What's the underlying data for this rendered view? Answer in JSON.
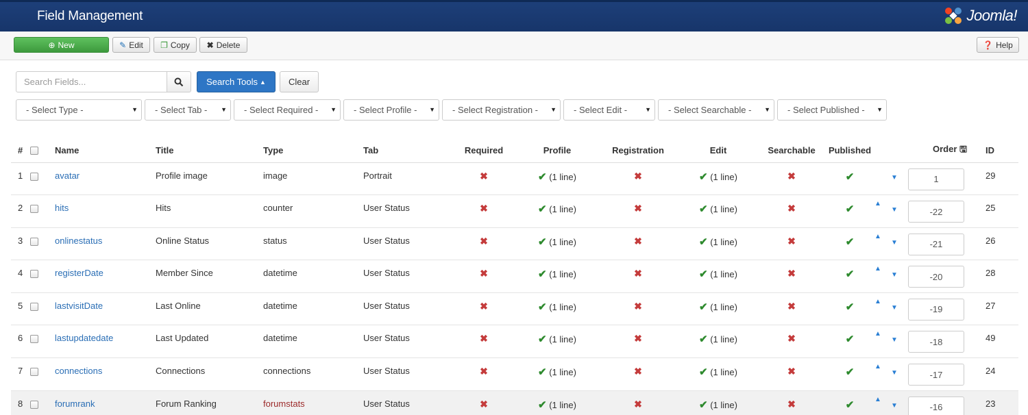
{
  "header": {
    "title": "Field Management",
    "brand": "Joomla!"
  },
  "toolbar": {
    "new_label": "New",
    "edit_label": "Edit",
    "copy_label": "Copy",
    "delete_label": "Delete",
    "help_label": "Help"
  },
  "search": {
    "placeholder": "Search Fields...",
    "tools_label": "Search Tools",
    "clear_label": "Clear"
  },
  "filters": [
    "- Select Type -",
    "- Select Tab -",
    "- Select Required -",
    "- Select Profile -",
    "- Select Registration -",
    "- Select Edit -",
    "- Select Searchable -",
    "- Select Published -"
  ],
  "table": {
    "headers": {
      "num": "#",
      "name": "Name",
      "title": "Title",
      "type": "Type",
      "tab": "Tab",
      "required": "Required",
      "profile": "Profile",
      "registration": "Registration",
      "edit": "Edit",
      "searchable": "Searchable",
      "published": "Published",
      "order": "Order",
      "id": "ID"
    },
    "line_text": "(1 line)",
    "rows": [
      {
        "num": "1",
        "name": "avatar",
        "title": "Profile image",
        "type": "image",
        "tab": "Portrait",
        "order": "1",
        "id": "29"
      },
      {
        "num": "2",
        "name": "hits",
        "title": "Hits",
        "type": "counter",
        "tab": "User Status",
        "order": "-22",
        "id": "25"
      },
      {
        "num": "3",
        "name": "onlinestatus",
        "title": "Online Status",
        "type": "status",
        "tab": "User Status",
        "order": "-21",
        "id": "26"
      },
      {
        "num": "4",
        "name": "registerDate",
        "title": "Member Since",
        "type": "datetime",
        "tab": "User Status",
        "order": "-20",
        "id": "28"
      },
      {
        "num": "5",
        "name": "lastvisitDate",
        "title": "Last Online",
        "type": "datetime",
        "tab": "User Status",
        "order": "-19",
        "id": "27"
      },
      {
        "num": "6",
        "name": "lastupdatedate",
        "title": "Last Updated",
        "type": "datetime",
        "tab": "User Status",
        "order": "-18",
        "id": "49"
      },
      {
        "num": "7",
        "name": "connections",
        "title": "Connections",
        "type": "connections",
        "tab": "User Status",
        "order": "-17",
        "id": "24"
      },
      {
        "num": "8",
        "name": "forumrank",
        "title": "Forum Ranking",
        "type": "forumstats",
        "tab": "User Status",
        "order": "-16",
        "id": "23"
      }
    ]
  }
}
